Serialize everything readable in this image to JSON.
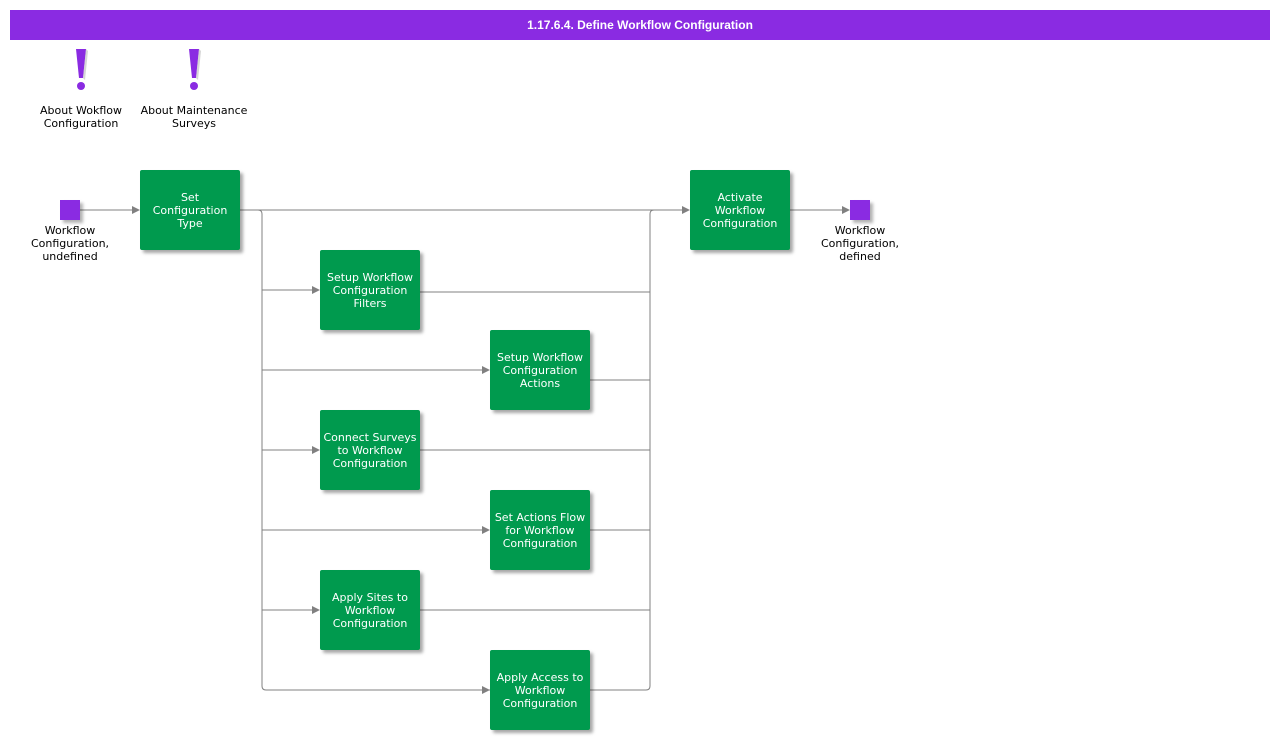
{
  "title": "1.17.6.4. Define Workflow Configuration",
  "colors": {
    "title_bar": "#8a2be2",
    "task": "#009a4e",
    "state": "#8a2be2",
    "edge": "#808080"
  },
  "notes": [
    {
      "icon": "exclamation-icon",
      "label": "About Wokflow Configuration"
    },
    {
      "icon": "exclamation-icon",
      "label": "About Maintenance Surveys"
    }
  ],
  "states": {
    "start": "Workflow Configuration, undefined",
    "end": "Workflow Configuration, defined"
  },
  "tasks": {
    "set_type": "Set Configuration Type",
    "setup_filters": "Setup Workflow Configuration Filters",
    "setup_actions": "Setup Workflow Configuration Actions",
    "connect_surveys": "Connect Surveys to Workflow Configuration",
    "actions_flow": "Set Actions Flow for Workflow Configuration",
    "apply_sites": "Apply Sites to Workflow Configuration",
    "apply_access": "Apply Access to Workflow Configuration",
    "activate": "Activate Workflow Configuration"
  }
}
